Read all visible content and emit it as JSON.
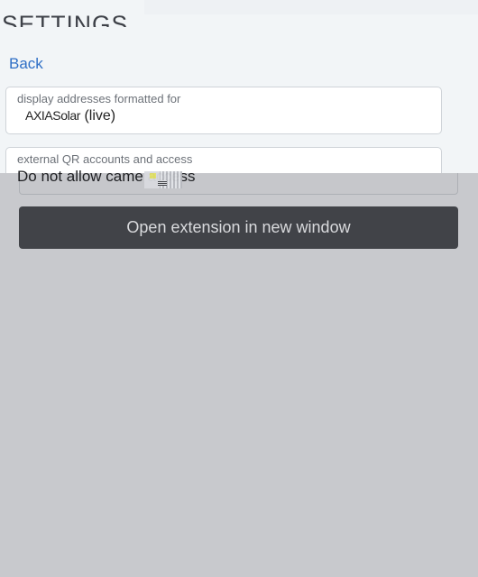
{
  "header": {
    "title": "SETTINGS",
    "back_label": "Back"
  },
  "address_format": {
    "label": "display addresses formatted for",
    "value_token": "AXIASolar",
    "value_network": "(live)"
  },
  "qr_access": {
    "label": "external QR accounts and access",
    "selected_value": "Do not allow came    access"
  },
  "actions": {
    "open_window_label": "Open extension in new window"
  }
}
